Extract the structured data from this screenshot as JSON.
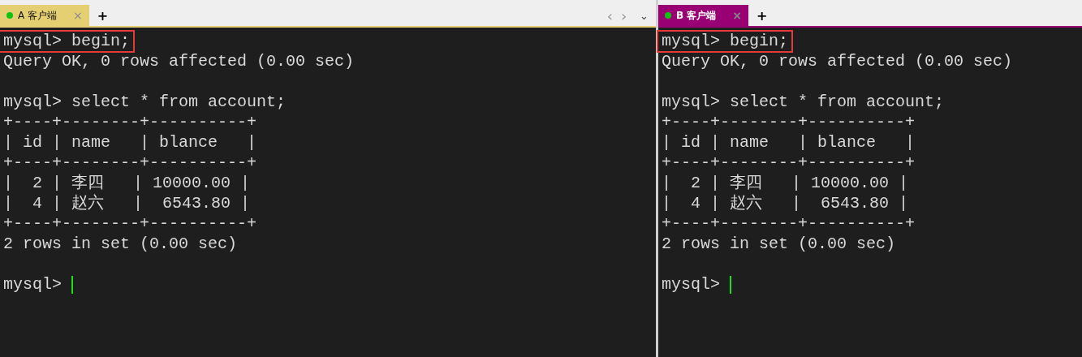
{
  "panes": [
    {
      "tab": {
        "label": "A 客户端",
        "close": "×",
        "selected": true,
        "color": "#e5cf73"
      },
      "new_tab": "+",
      "nav": [
        "‹",
        "›",
        "⌄"
      ],
      "lines": [
        {
          "kind": "line",
          "text": "mysql> begin;",
          "highlighted": true
        },
        {
          "kind": "line",
          "text": "Query OK, 0 rows affected (0.00 sec)",
          "highlighted": false
        },
        {
          "kind": "blank"
        },
        {
          "kind": "line",
          "text": "mysql> select * from account;",
          "highlighted": false
        },
        {
          "kind": "line",
          "text": "+----+--------+----------+",
          "highlighted": false
        },
        {
          "kind": "line",
          "text": "| id | name   | blance   |",
          "highlighted": false
        },
        {
          "kind": "line",
          "text": "+----+--------+----------+",
          "highlighted": false
        },
        {
          "kind": "line",
          "text": "|  2 | 李四   | 10000.00 |",
          "highlighted": false
        },
        {
          "kind": "line",
          "text": "|  4 | 赵六   |  6543.80 |",
          "highlighted": false
        },
        {
          "kind": "line",
          "text": "+----+--------+----------+",
          "highlighted": false
        },
        {
          "kind": "line",
          "text": "2 rows in set (0.00 sec)",
          "highlighted": false
        },
        {
          "kind": "blank"
        },
        {
          "kind": "prompt",
          "text": "mysql>"
        }
      ]
    },
    {
      "tab": {
        "label": "B 客户端",
        "close": "×",
        "selected": true,
        "color": "#990073"
      },
      "new_tab": "+",
      "lines": [
        {
          "kind": "line",
          "text": "mysql> begin;",
          "highlighted": true
        },
        {
          "kind": "line",
          "text": "Query OK, 0 rows affected (0.00 sec)",
          "highlighted": false
        },
        {
          "kind": "blank"
        },
        {
          "kind": "line",
          "text": "mysql> select * from account;",
          "highlighted": false
        },
        {
          "kind": "line",
          "text": "+----+--------+----------+",
          "highlighted": false
        },
        {
          "kind": "line",
          "text": "| id | name   | blance   |",
          "highlighted": false
        },
        {
          "kind": "line",
          "text": "+----+--------+----------+",
          "highlighted": false
        },
        {
          "kind": "line",
          "text": "|  2 | 李四   | 10000.00 |",
          "highlighted": false
        },
        {
          "kind": "line",
          "text": "|  4 | 赵六   |  6543.80 |",
          "highlighted": false
        },
        {
          "kind": "line",
          "text": "+----+--------+----------+",
          "highlighted": false
        },
        {
          "kind": "line",
          "text": "2 rows in set (0.00 sec)",
          "highlighted": false
        },
        {
          "kind": "blank"
        },
        {
          "kind": "prompt",
          "text": "mysql>"
        }
      ]
    }
  ]
}
